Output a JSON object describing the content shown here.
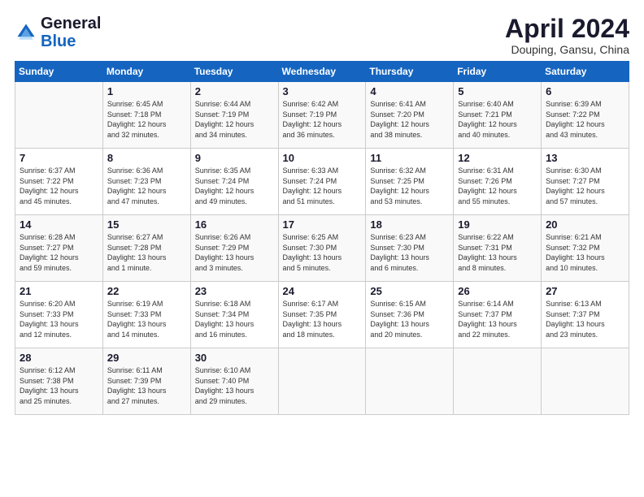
{
  "header": {
    "logo_general": "General",
    "logo_blue": "Blue",
    "month_title": "April 2024",
    "location": "Douping, Gansu, China"
  },
  "days_header": [
    "Sunday",
    "Monday",
    "Tuesday",
    "Wednesday",
    "Thursday",
    "Friday",
    "Saturday"
  ],
  "weeks": [
    [
      {
        "num": "",
        "info": ""
      },
      {
        "num": "1",
        "info": "Sunrise: 6:45 AM\nSunset: 7:18 PM\nDaylight: 12 hours\nand 32 minutes."
      },
      {
        "num": "2",
        "info": "Sunrise: 6:44 AM\nSunset: 7:19 PM\nDaylight: 12 hours\nand 34 minutes."
      },
      {
        "num": "3",
        "info": "Sunrise: 6:42 AM\nSunset: 7:19 PM\nDaylight: 12 hours\nand 36 minutes."
      },
      {
        "num": "4",
        "info": "Sunrise: 6:41 AM\nSunset: 7:20 PM\nDaylight: 12 hours\nand 38 minutes."
      },
      {
        "num": "5",
        "info": "Sunrise: 6:40 AM\nSunset: 7:21 PM\nDaylight: 12 hours\nand 40 minutes."
      },
      {
        "num": "6",
        "info": "Sunrise: 6:39 AM\nSunset: 7:22 PM\nDaylight: 12 hours\nand 43 minutes."
      }
    ],
    [
      {
        "num": "7",
        "info": "Sunrise: 6:37 AM\nSunset: 7:22 PM\nDaylight: 12 hours\nand 45 minutes."
      },
      {
        "num": "8",
        "info": "Sunrise: 6:36 AM\nSunset: 7:23 PM\nDaylight: 12 hours\nand 47 minutes."
      },
      {
        "num": "9",
        "info": "Sunrise: 6:35 AM\nSunset: 7:24 PM\nDaylight: 12 hours\nand 49 minutes."
      },
      {
        "num": "10",
        "info": "Sunrise: 6:33 AM\nSunset: 7:24 PM\nDaylight: 12 hours\nand 51 minutes."
      },
      {
        "num": "11",
        "info": "Sunrise: 6:32 AM\nSunset: 7:25 PM\nDaylight: 12 hours\nand 53 minutes."
      },
      {
        "num": "12",
        "info": "Sunrise: 6:31 AM\nSunset: 7:26 PM\nDaylight: 12 hours\nand 55 minutes."
      },
      {
        "num": "13",
        "info": "Sunrise: 6:30 AM\nSunset: 7:27 PM\nDaylight: 12 hours\nand 57 minutes."
      }
    ],
    [
      {
        "num": "14",
        "info": "Sunrise: 6:28 AM\nSunset: 7:27 PM\nDaylight: 12 hours\nand 59 minutes."
      },
      {
        "num": "15",
        "info": "Sunrise: 6:27 AM\nSunset: 7:28 PM\nDaylight: 13 hours\nand 1 minute."
      },
      {
        "num": "16",
        "info": "Sunrise: 6:26 AM\nSunset: 7:29 PM\nDaylight: 13 hours\nand 3 minutes."
      },
      {
        "num": "17",
        "info": "Sunrise: 6:25 AM\nSunset: 7:30 PM\nDaylight: 13 hours\nand 5 minutes."
      },
      {
        "num": "18",
        "info": "Sunrise: 6:23 AM\nSunset: 7:30 PM\nDaylight: 13 hours\nand 6 minutes."
      },
      {
        "num": "19",
        "info": "Sunrise: 6:22 AM\nSunset: 7:31 PM\nDaylight: 13 hours\nand 8 minutes."
      },
      {
        "num": "20",
        "info": "Sunrise: 6:21 AM\nSunset: 7:32 PM\nDaylight: 13 hours\nand 10 minutes."
      }
    ],
    [
      {
        "num": "21",
        "info": "Sunrise: 6:20 AM\nSunset: 7:33 PM\nDaylight: 13 hours\nand 12 minutes."
      },
      {
        "num": "22",
        "info": "Sunrise: 6:19 AM\nSunset: 7:33 PM\nDaylight: 13 hours\nand 14 minutes."
      },
      {
        "num": "23",
        "info": "Sunrise: 6:18 AM\nSunset: 7:34 PM\nDaylight: 13 hours\nand 16 minutes."
      },
      {
        "num": "24",
        "info": "Sunrise: 6:17 AM\nSunset: 7:35 PM\nDaylight: 13 hours\nand 18 minutes."
      },
      {
        "num": "25",
        "info": "Sunrise: 6:15 AM\nSunset: 7:36 PM\nDaylight: 13 hours\nand 20 minutes."
      },
      {
        "num": "26",
        "info": "Sunrise: 6:14 AM\nSunset: 7:37 PM\nDaylight: 13 hours\nand 22 minutes."
      },
      {
        "num": "27",
        "info": "Sunrise: 6:13 AM\nSunset: 7:37 PM\nDaylight: 13 hours\nand 23 minutes."
      }
    ],
    [
      {
        "num": "28",
        "info": "Sunrise: 6:12 AM\nSunset: 7:38 PM\nDaylight: 13 hours\nand 25 minutes."
      },
      {
        "num": "29",
        "info": "Sunrise: 6:11 AM\nSunset: 7:39 PM\nDaylight: 13 hours\nand 27 minutes."
      },
      {
        "num": "30",
        "info": "Sunrise: 6:10 AM\nSunset: 7:40 PM\nDaylight: 13 hours\nand 29 minutes."
      },
      {
        "num": "",
        "info": ""
      },
      {
        "num": "",
        "info": ""
      },
      {
        "num": "",
        "info": ""
      },
      {
        "num": "",
        "info": ""
      }
    ]
  ]
}
